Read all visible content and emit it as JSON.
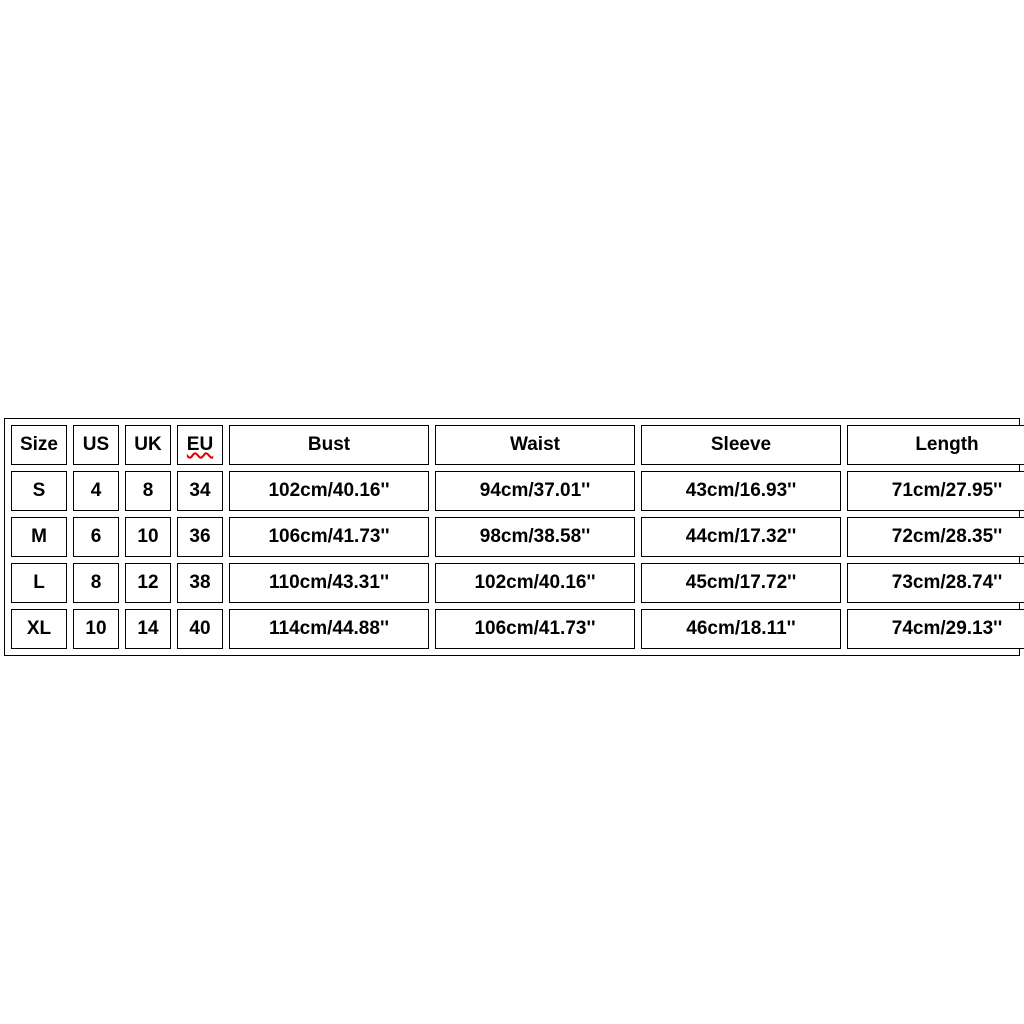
{
  "chart_data": {
    "type": "table",
    "headers": [
      "Size",
      "US",
      "UK",
      "EU",
      "Bust",
      "Waist",
      "Sleeve",
      "Length"
    ],
    "rows": [
      {
        "size": "S",
        "us": "4",
        "uk": "8",
        "eu": "34",
        "bust": "102cm/40.16''",
        "waist": "94cm/37.01''",
        "sleeve": "43cm/16.93''",
        "length": "71cm/27.95''"
      },
      {
        "size": "M",
        "us": "6",
        "uk": "10",
        "eu": "36",
        "bust": "106cm/41.73''",
        "waist": "98cm/38.58''",
        "sleeve": "44cm/17.32''",
        "length": "72cm/28.35''"
      },
      {
        "size": "L",
        "us": "8",
        "uk": "12",
        "eu": "38",
        "bust": "110cm/43.31''",
        "waist": "102cm/40.16''",
        "sleeve": "45cm/17.72''",
        "length": "73cm/28.74''"
      },
      {
        "size": "XL",
        "us": "10",
        "uk": "14",
        "eu": "40",
        "bust": "114cm/44.88''",
        "waist": "106cm/41.73''",
        "sleeve": "46cm/18.11''",
        "length": "74cm/29.13''"
      }
    ]
  }
}
